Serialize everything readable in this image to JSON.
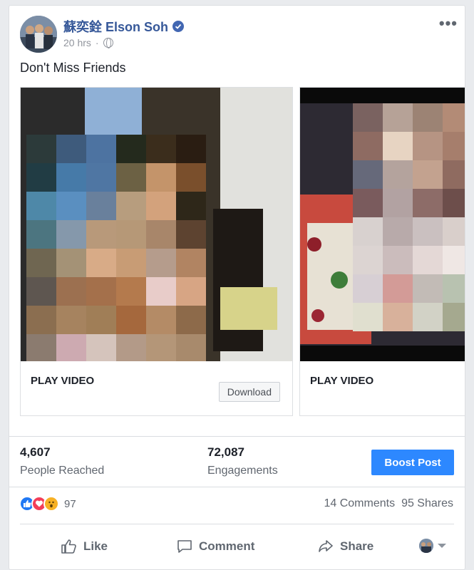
{
  "post": {
    "author": "蘇奕銓 Elson Soh",
    "time": "20 hrs",
    "separator": "·",
    "text": "Don't Miss Friends",
    "more_icon": "•••"
  },
  "carousel": [
    {
      "cta": "PLAY VIDEO",
      "button": "Download",
      "media": "censored-video-thumbnail"
    },
    {
      "cta": "PLAY VIDEO",
      "media": "censored-video-thumbnail"
    }
  ],
  "insights": {
    "reached_value": "4,607",
    "reached_label": "People Reached",
    "engagements_value": "72,087",
    "engagements_label": "Engagements",
    "boost_label": "Boost Post"
  },
  "reactions": {
    "count": "97",
    "comments": "14 Comments",
    "shares": "95 Shares"
  },
  "actions": {
    "like": "Like",
    "comment": "Comment",
    "share": "Share"
  },
  "colors": {
    "brand_link": "#365899",
    "boost_blue": "#2d88ff"
  }
}
